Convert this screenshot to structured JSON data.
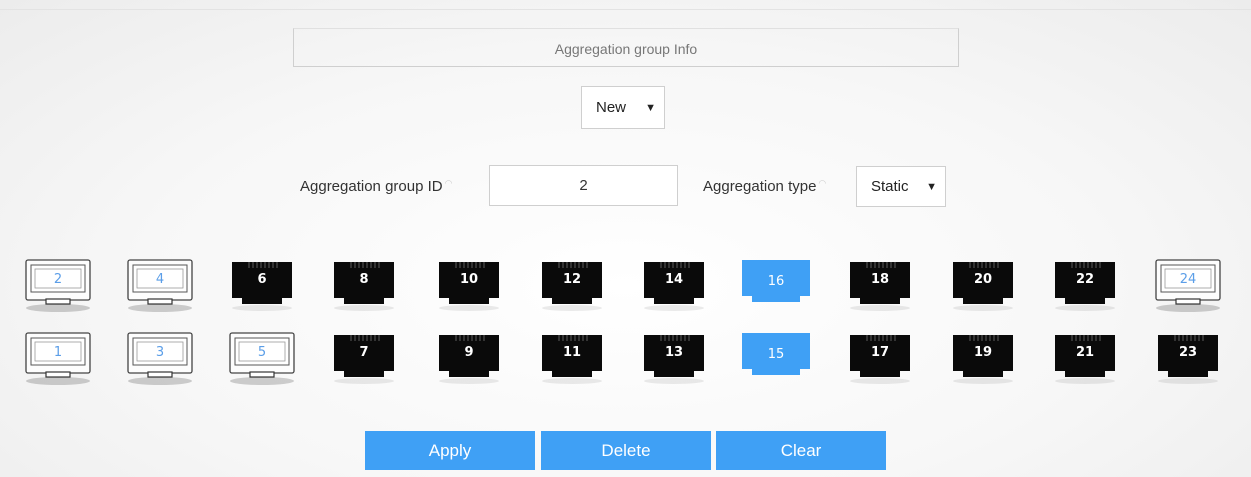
{
  "header": {
    "title": "Aggregation group Info"
  },
  "mode_select": {
    "value": "New"
  },
  "form": {
    "group_id_label": "Aggregation group ID",
    "group_id_value": "2",
    "type_label": "Aggregation type",
    "type_value": "Static"
  },
  "ports": {
    "top_row": [
      {
        "num": "2",
        "state": "empty"
      },
      {
        "num": "4",
        "state": "empty"
      },
      {
        "num": "6",
        "state": "linked"
      },
      {
        "num": "8",
        "state": "linked"
      },
      {
        "num": "10",
        "state": "linked"
      },
      {
        "num": "12",
        "state": "linked"
      },
      {
        "num": "14",
        "state": "linked"
      },
      {
        "num": "16",
        "state": "selected"
      },
      {
        "num": "18",
        "state": "linked"
      },
      {
        "num": "20",
        "state": "linked"
      },
      {
        "num": "22",
        "state": "linked"
      },
      {
        "num": "24",
        "state": "empty"
      }
    ],
    "bottom_row": [
      {
        "num": "1",
        "state": "empty"
      },
      {
        "num": "3",
        "state": "empty"
      },
      {
        "num": "5",
        "state": "empty"
      },
      {
        "num": "7",
        "state": "linked"
      },
      {
        "num": "9",
        "state": "linked"
      },
      {
        "num": "11",
        "state": "linked"
      },
      {
        "num": "13",
        "state": "linked"
      },
      {
        "num": "15",
        "state": "selected"
      },
      {
        "num": "17",
        "state": "linked"
      },
      {
        "num": "19",
        "state": "linked"
      },
      {
        "num": "21",
        "state": "linked"
      },
      {
        "num": "23",
        "state": "linked"
      }
    ]
  },
  "buttons": {
    "apply": "Apply",
    "delete": "Delete",
    "clear": "Clear"
  },
  "colors": {
    "accent": "#3fa0f5",
    "port_dark": "#0a0a0a",
    "port_number_empty": "#5b9ee8"
  }
}
